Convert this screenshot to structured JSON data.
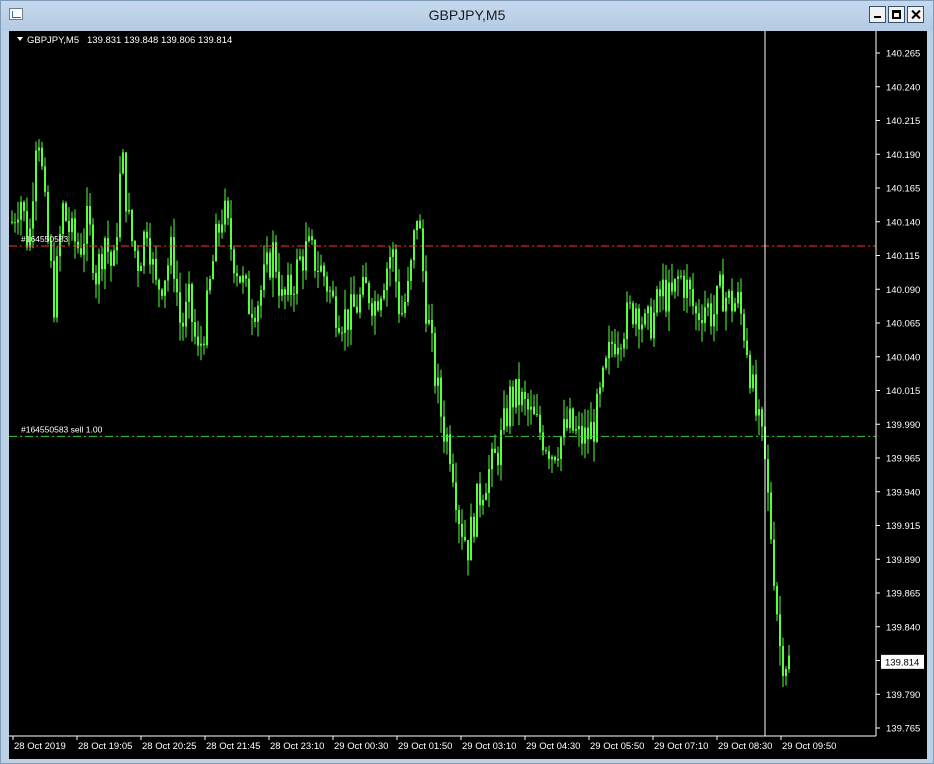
{
  "window": {
    "title": "GBPJPY,M5"
  },
  "chart_header": {
    "symbol_text": "GBPJPY,M5",
    "ohlc_text": "139.831 139.848 139.806 139.814"
  },
  "orders": [
    {
      "label": "#164550583",
      "price": 140.122,
      "color": "#ff3333"
    },
    {
      "label": "#164550583 sell 1.00",
      "price": 139.981,
      "color": "#33cc33"
    }
  ],
  "current_price": "139.814",
  "colors": {
    "candle": "#55ff3a",
    "background": "#000000",
    "axis": "#ffffff"
  },
  "chart_data": {
    "type": "line",
    "symbol": "GBPJPY",
    "timeframe": "M5",
    "ylim": [
      139.755,
      140.275
    ],
    "y_ticks": [
      "140.265",
      "140.240",
      "140.215",
      "140.190",
      "140.165",
      "140.140",
      "140.115",
      "140.090",
      "140.065",
      "140.040",
      "140.015",
      "139.990",
      "139.965",
      "139.940",
      "139.915",
      "139.890",
      "139.865",
      "139.840",
      "139.815",
      "139.790",
      "139.765"
    ],
    "x_ticks": [
      "28 Oct 2019",
      "28 Oct 19:05",
      "28 Oct 20:25",
      "28 Oct 21:45",
      "28 Oct 23:10",
      "29 Oct 00:30",
      "29 Oct 01:50",
      "29 Oct 03:10",
      "29 Oct 04:30",
      "29 Oct 05:50",
      "29 Oct 07:10",
      "29 Oct 08:30",
      "29 Oct 09:50"
    ],
    "last": {
      "open": 139.831,
      "high": 139.848,
      "low": 139.806,
      "close": 139.814
    },
    "series": [
      {
        "values": [
          140.14,
          140.16,
          140.12,
          140.22,
          140.14,
          140.08,
          140.15,
          140.13,
          140.12,
          140.14,
          140.1,
          140.13,
          140.1,
          140.19,
          140.13,
          140.11,
          140.14,
          140.09,
          140.1,
          140.12,
          140.06,
          140.08,
          140.04,
          140.07,
          140.12,
          140.15,
          140.12,
          140.1,
          140.08,
          140.08,
          140.1,
          140.12,
          140.08,
          140.09,
          140.11,
          140.12,
          140.11,
          140.1,
          140.08,
          140.07,
          140.07,
          140.08,
          140.09,
          140.08,
          140.1,
          140.12,
          140.07,
          140.09,
          140.15,
          140.08,
          140.03,
          139.99,
          139.97,
          139.92,
          139.9,
          139.93,
          139.95,
          139.96,
          139.98,
          140.01,
          140.01,
          140.0,
          139.99,
          139.98,
          139.97,
          139.98,
          139.99,
          139.98,
          139.98,
          139.99,
          140.02,
          140.05,
          140.06,
          140.07,
          140.08,
          140.06,
          140.07,
          140.09,
          140.08,
          140.1,
          140.09,
          140.07,
          140.08,
          140.07,
          140.09,
          140.08,
          140.08,
          140.05,
          140.0,
          139.97,
          139.9,
          139.82,
          139.814
        ]
      }
    ]
  }
}
